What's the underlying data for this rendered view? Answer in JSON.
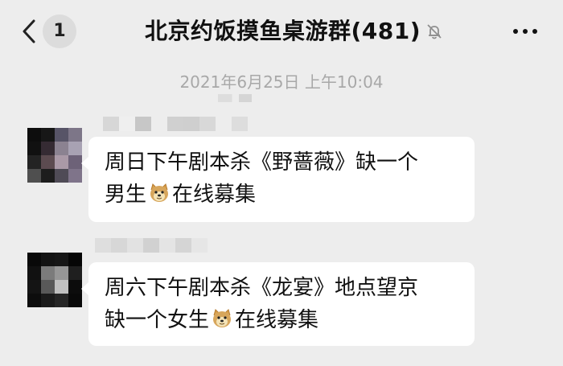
{
  "header": {
    "unread_count": "1",
    "title": "北京约饭摸鱼桌游群(481)"
  },
  "timestamp": "2021年6月25日 上午10:04",
  "messages": [
    {
      "line1": "周日下午剧本杀《野蔷薇》缺一个",
      "line2_before": "男生",
      "line2_after": "在线募集"
    },
    {
      "line1": "周六下午剧本杀《龙宴》地点望京",
      "line2_before": "缺一个女生",
      "line2_after": "在线募集"
    }
  ],
  "icons": [
    "back-arrow-icon",
    "mute-bell-icon",
    "more-options-icon",
    "doge-emoji-icon"
  ]
}
